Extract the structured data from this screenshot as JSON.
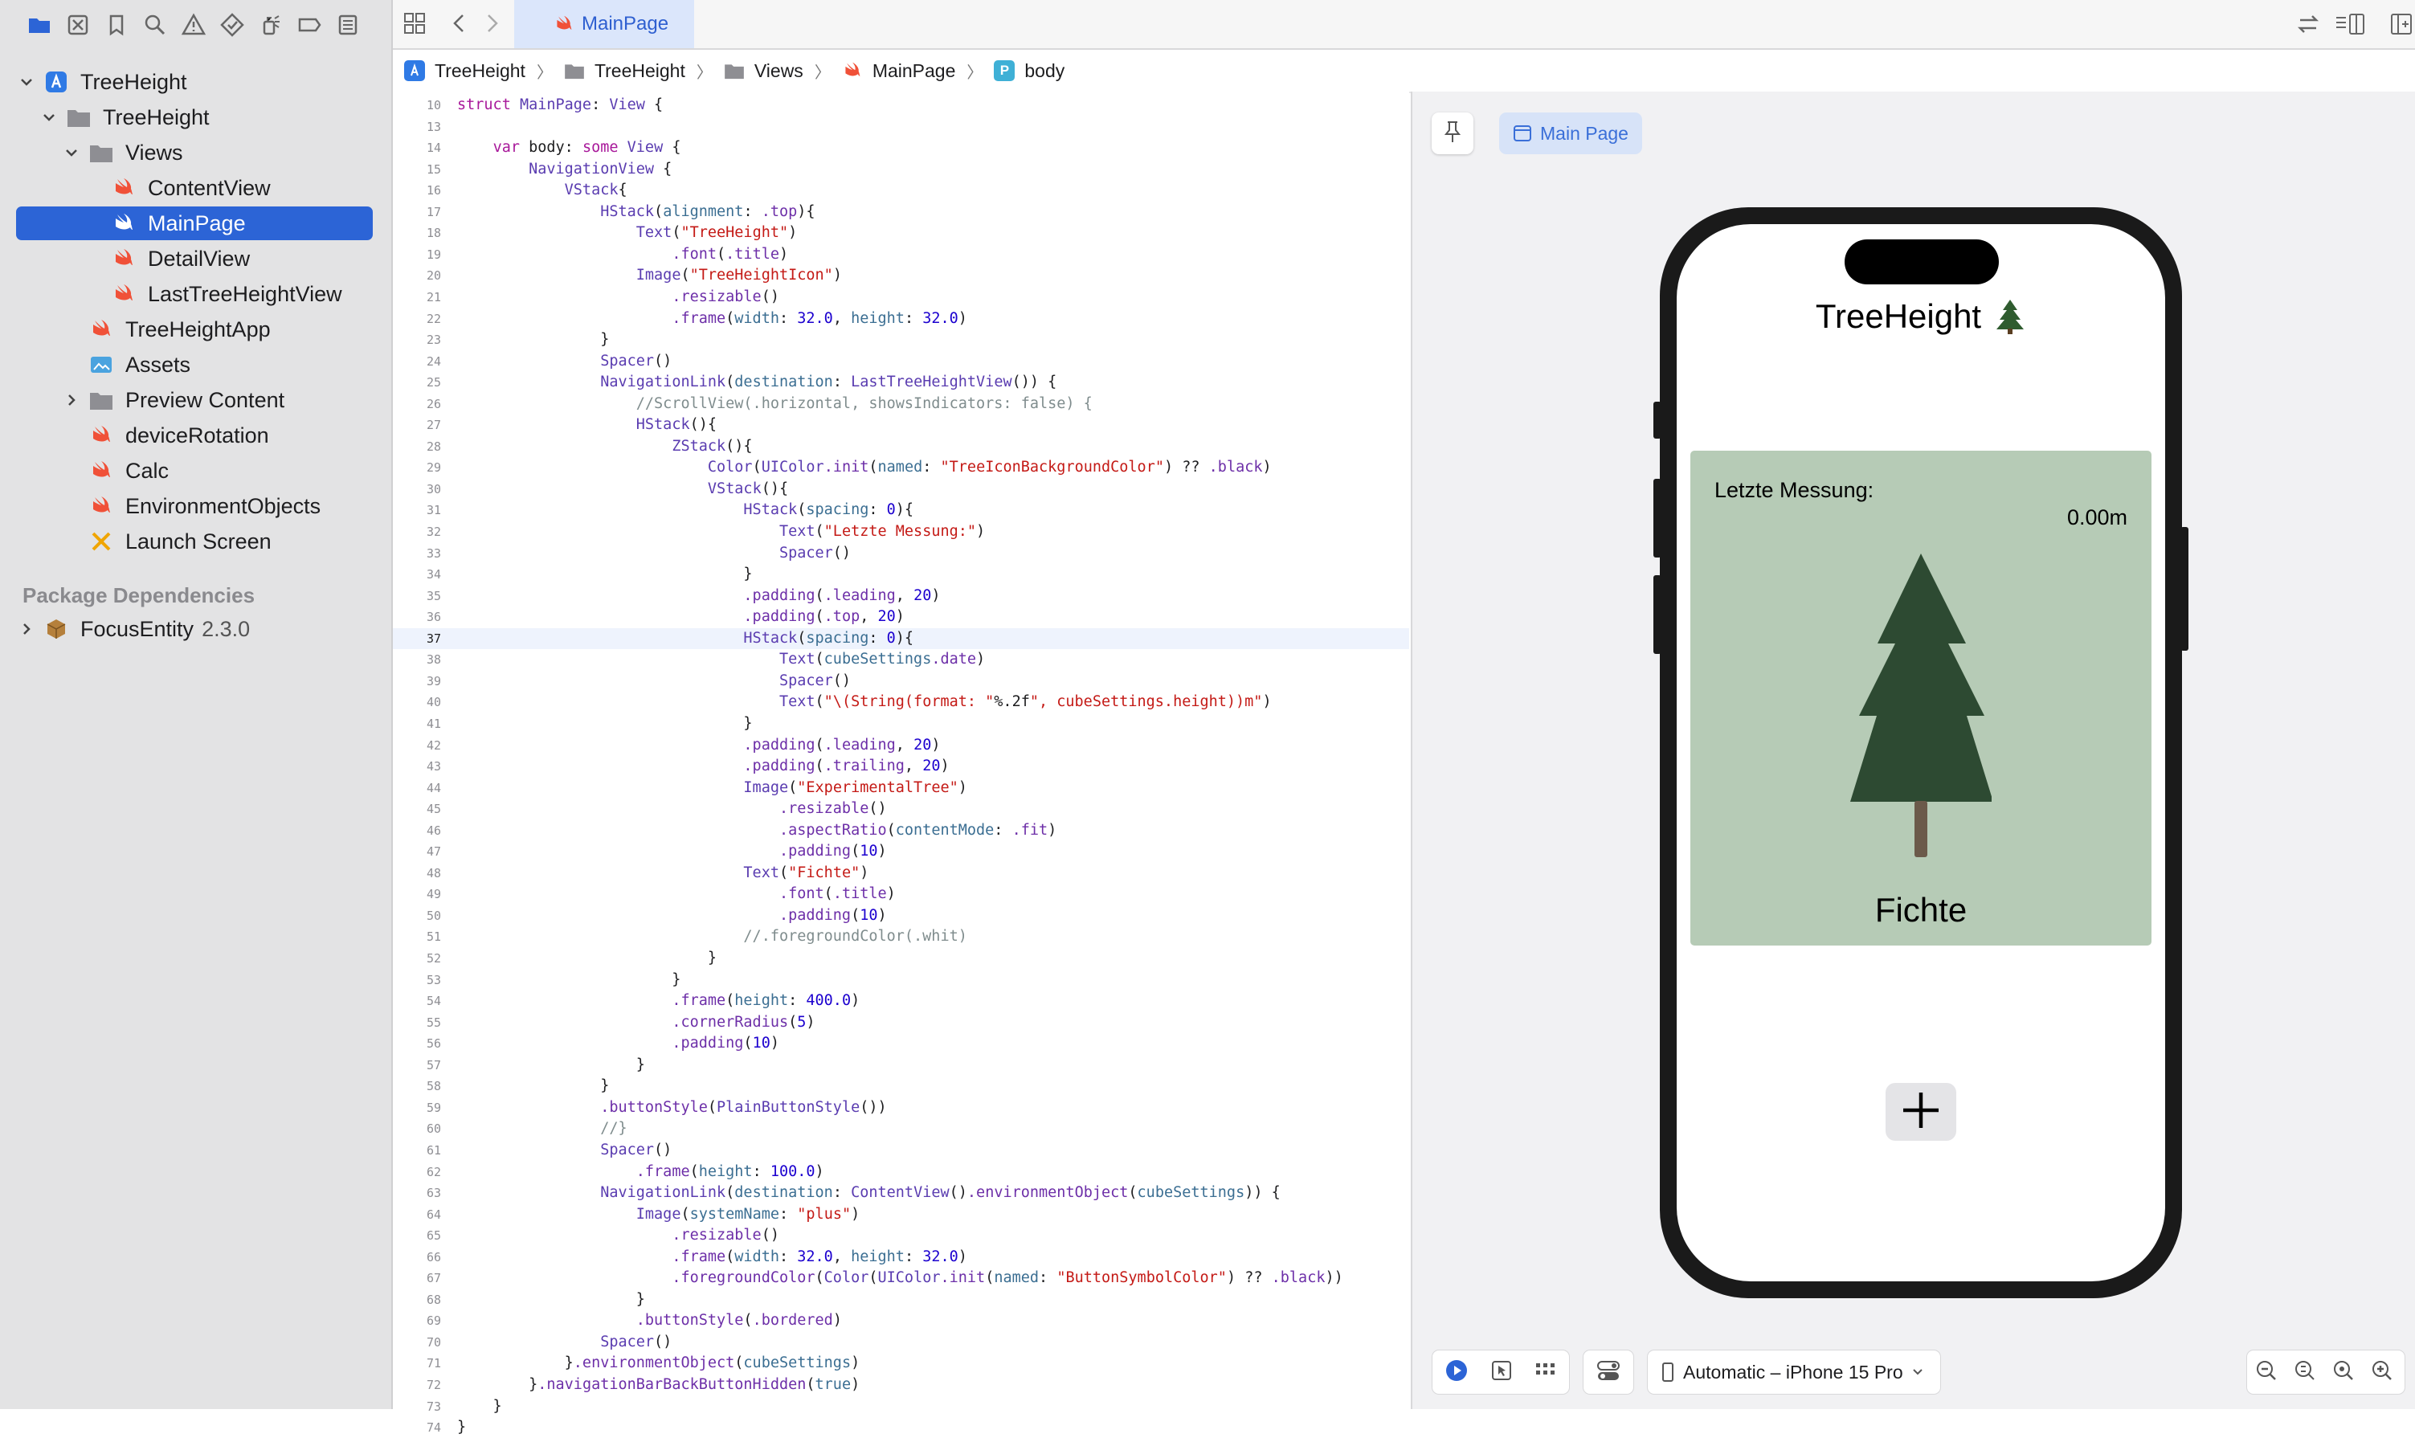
{
  "sidebar": {
    "project": "TreeHeight",
    "items": [
      {
        "label": "TreeHeight"
      },
      {
        "label": "TreeHeight"
      },
      {
        "label": "Views"
      },
      {
        "label": "ContentView"
      },
      {
        "label": "MainPage"
      },
      {
        "label": "DetailView"
      },
      {
        "label": "LastTreeHeightView"
      },
      {
        "label": "TreeHeightApp"
      },
      {
        "label": "Assets"
      },
      {
        "label": "Preview Content"
      },
      {
        "label": "deviceRotation"
      },
      {
        "label": "Calc"
      },
      {
        "label": "EnvironmentObjects"
      },
      {
        "label": "Launch Screen"
      }
    ],
    "package_header": "Package Dependencies",
    "package": {
      "name": "FocusEntity",
      "version": "2.3.0"
    }
  },
  "tab": {
    "label": "MainPage"
  },
  "jumpbar": [
    "TreeHeight",
    "TreeHeight",
    "Views",
    "MainPage",
    "body"
  ],
  "editor": {
    "current_line": 37,
    "lines": [
      {
        "n": "10",
        "t": "struct MainPage: View {"
      },
      {
        "n": "13",
        "t": ""
      },
      {
        "n": "14",
        "t": "    var body: some View {"
      },
      {
        "n": "15",
        "t": "        NavigationView {"
      },
      {
        "n": "16",
        "t": "            VStack{"
      },
      {
        "n": "17",
        "t": "                HStack(alignment: .top){"
      },
      {
        "n": "18",
        "t": "                    Text(\"TreeHeight\")"
      },
      {
        "n": "19",
        "t": "                        .font(.title)"
      },
      {
        "n": "20",
        "t": "                    Image(\"TreeHeightIcon\")"
      },
      {
        "n": "21",
        "t": "                        .resizable()"
      },
      {
        "n": "22",
        "t": "                        .frame(width: 32.0, height: 32.0)"
      },
      {
        "n": "23",
        "t": "                }"
      },
      {
        "n": "24",
        "t": "                Spacer()"
      },
      {
        "n": "25",
        "t": "                NavigationLink(destination: LastTreeHeightView()) {"
      },
      {
        "n": "26",
        "t": "                    //ScrollView(.horizontal, showsIndicators: false) {"
      },
      {
        "n": "27",
        "t": "                    HStack(){"
      },
      {
        "n": "28",
        "t": "                        ZStack(){"
      },
      {
        "n": "29",
        "t": "                            Color(UIColor.init(named: \"TreeIconBackgroundColor\") ?? .black)"
      },
      {
        "n": "30",
        "t": "                            VStack(){"
      },
      {
        "n": "31",
        "t": "                                HStack(spacing: 0){"
      },
      {
        "n": "32",
        "t": "                                    Text(\"Letzte Messung:\")"
      },
      {
        "n": "33",
        "t": "                                    Spacer()"
      },
      {
        "n": "34",
        "t": "                                }"
      },
      {
        "n": "35",
        "t": "                                .padding(.leading, 20)"
      },
      {
        "n": "36",
        "t": "                                .padding(.top, 20)"
      },
      {
        "n": "37",
        "t": "                                HStack(spacing: 0){"
      },
      {
        "n": "38",
        "t": "                                    Text(cubeSettings.date)"
      },
      {
        "n": "39",
        "t": "                                    Spacer()"
      },
      {
        "n": "40",
        "t": "                                    Text(\"\\(String(format: \"%.2f\", cubeSettings.height))m\")"
      },
      {
        "n": "41",
        "t": "                                }"
      },
      {
        "n": "42",
        "t": "                                .padding(.leading, 20)"
      },
      {
        "n": "43",
        "t": "                                .padding(.trailing, 20)"
      },
      {
        "n": "44",
        "t": "                                Image(\"ExperimentalTree\")"
      },
      {
        "n": "45",
        "t": "                                    .resizable()"
      },
      {
        "n": "46",
        "t": "                                    .aspectRatio(contentMode: .fit)"
      },
      {
        "n": "47",
        "t": "                                    .padding(10)"
      },
      {
        "n": "48",
        "t": "                                Text(\"Fichte\")"
      },
      {
        "n": "49",
        "t": "                                    .font(.title)"
      },
      {
        "n": "50",
        "t": "                                    .padding(10)"
      },
      {
        "n": "51",
        "t": "                                //.foregroundColor(.whit)"
      },
      {
        "n": "52",
        "t": "                            }"
      },
      {
        "n": "53",
        "t": "                        }"
      },
      {
        "n": "54",
        "t": "                        .frame(height: 400.0)"
      },
      {
        "n": "55",
        "t": "                        .cornerRadius(5)"
      },
      {
        "n": "56",
        "t": "                        .padding(10)"
      },
      {
        "n": "57",
        "t": "                    }"
      },
      {
        "n": "58",
        "t": "                }"
      },
      {
        "n": "59",
        "t": "                .buttonStyle(PlainButtonStyle())"
      },
      {
        "n": "60",
        "t": "                //}"
      },
      {
        "n": "61",
        "t": "                Spacer()"
      },
      {
        "n": "62",
        "t": "                    .frame(height: 100.0)"
      },
      {
        "n": "63",
        "t": "                NavigationLink(destination: ContentView().environmentObject(cubeSettings)) {"
      },
      {
        "n": "64",
        "t": "                    Image(systemName: \"plus\")"
      },
      {
        "n": "65",
        "t": "                        .resizable()"
      },
      {
        "n": "66",
        "t": "                        .frame(width: 32.0, height: 32.0)"
      },
      {
        "n": "67",
        "t": "                        .foregroundColor(Color(UIColor.init(named: \"ButtonSymbolColor\") ?? .black))"
      },
      {
        "n": "68",
        "t": "                    }"
      },
      {
        "n": "69",
        "t": "                    .buttonStyle(.bordered)"
      },
      {
        "n": "70",
        "t": "                Spacer()"
      },
      {
        "n": "71",
        "t": "            }.environmentObject(cubeSettings)"
      },
      {
        "n": "72",
        "t": "        }.navigationBarBackButtonHidden(true)"
      },
      {
        "n": "73",
        "t": "    }"
      },
      {
        "n": "74",
        "t": "}"
      }
    ]
  },
  "canvas": {
    "preview_tab": "Main Page",
    "device_selector": "Automatic – iPhone 15 Pro",
    "app": {
      "title": "TreeHeight",
      "card_label": "Letzte Messung:",
      "card_value": "0.00m",
      "tree_name": "Fichte",
      "card_color": "#b6cbb6",
      "tree_color": "#2d4a32"
    }
  },
  "colors": {
    "accent": "#2c64d6",
    "swift": "#f05138"
  }
}
